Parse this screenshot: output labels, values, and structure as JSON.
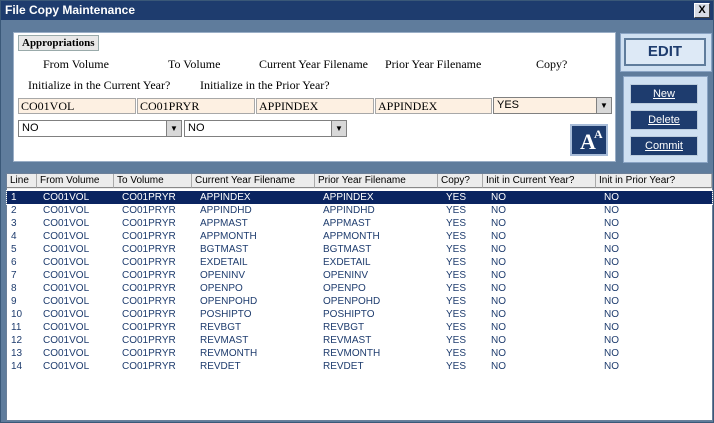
{
  "window": {
    "title": "File Copy Maintenance",
    "close_label": "X"
  },
  "form": {
    "section_label": "Appropriations",
    "labels": {
      "from_volume": "From Volume",
      "to_volume": "To Volume",
      "current_year_filename": "Current Year Filename",
      "prior_year_filename": "Prior Year Filename",
      "copy": "Copy?",
      "init_current": "Initialize in the Current Year?",
      "init_prior": "Initialize in the Prior Year?"
    },
    "values": {
      "from_volume": "CO01VOL",
      "to_volume": "CO01PRYR",
      "current_year_filename": "APPINDEX",
      "prior_year_filename": "APPINDEX",
      "copy": "YES",
      "init_current": "NO",
      "init_prior": "NO"
    },
    "font_button": {
      "big": "A",
      "small": "A"
    }
  },
  "actions": {
    "edit": "EDIT",
    "new": "New",
    "delete": "Delete",
    "commit": "Commit"
  },
  "table": {
    "headers": [
      "Line",
      "From Volume",
      "To Volume",
      "Current Year Filename",
      "Prior Year Filename",
      "Copy?",
      "Init in Current Year?",
      "Init in Prior Year?"
    ],
    "rows": [
      [
        "1",
        "CO01VOL",
        "CO01PRYR",
        "APPINDEX",
        "APPINDEX",
        "YES",
        "NO",
        "NO"
      ],
      [
        "2",
        "CO01VOL",
        "CO01PRYR",
        "APPINDHD",
        "APPINDHD",
        "YES",
        "NO",
        "NO"
      ],
      [
        "3",
        "CO01VOL",
        "CO01PRYR",
        "APPMAST",
        "APPMAST",
        "YES",
        "NO",
        "NO"
      ],
      [
        "4",
        "CO01VOL",
        "CO01PRYR",
        "APPMONTH",
        "APPMONTH",
        "YES",
        "NO",
        "NO"
      ],
      [
        "5",
        "CO01VOL",
        "CO01PRYR",
        "BGTMAST",
        "BGTMAST",
        "YES",
        "NO",
        "NO"
      ],
      [
        "6",
        "CO01VOL",
        "CO01PRYR",
        "EXDETAIL",
        "EXDETAIL",
        "YES",
        "NO",
        "NO"
      ],
      [
        "7",
        "CO01VOL",
        "CO01PRYR",
        "OPENINV",
        "OPENINV",
        "YES",
        "NO",
        "NO"
      ],
      [
        "8",
        "CO01VOL",
        "CO01PRYR",
        "OPENPO",
        "OPENPO",
        "YES",
        "NO",
        "NO"
      ],
      [
        "9",
        "CO01VOL",
        "CO01PRYR",
        "OPENPOHD",
        "OPENPOHD",
        "YES",
        "NO",
        "NO"
      ],
      [
        "10",
        "CO01VOL",
        "CO01PRYR",
        "POSHIPTO",
        "POSHIPTO",
        "YES",
        "NO",
        "NO"
      ],
      [
        "11",
        "CO01VOL",
        "CO01PRYR",
        "REVBGT",
        "REVBGT",
        "YES",
        "NO",
        "NO"
      ],
      [
        "12",
        "CO01VOL",
        "CO01PRYR",
        "REVMAST",
        "REVMAST",
        "YES",
        "NO",
        "NO"
      ],
      [
        "13",
        "CO01VOL",
        "CO01PRYR",
        "REVMONTH",
        "REVMONTH",
        "YES",
        "NO",
        "NO"
      ],
      [
        "14",
        "CO01VOL",
        "CO01PRYR",
        "REVDET",
        "REVDET",
        "YES",
        "NO",
        "NO"
      ]
    ],
    "selected_row": 0
  },
  "colors": {
    "title_bar": "#1e3c6e",
    "selection": "#0a2460",
    "field_bg": "#fdf0e2",
    "window_bg": "#5f7c9c"
  },
  "icons": {
    "close": "close-icon",
    "dropdown": "chevron-down-icon",
    "font_size": "font-size-icon"
  }
}
